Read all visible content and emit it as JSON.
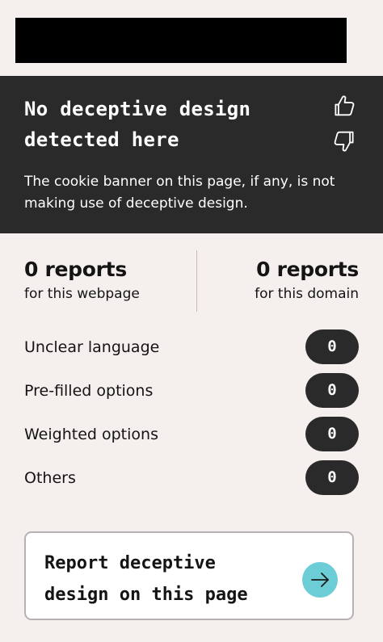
{
  "status": {
    "title": "No deceptive design detected here",
    "description": "The cookie banner on this page, if any, is not making use of deceptive design.",
    "icons": {
      "upvote": "thumbs-up-icon",
      "downvote": "thumbs-down-icon"
    }
  },
  "reports": {
    "webpage": {
      "count": "0 reports",
      "label": "for this webpage"
    },
    "domain": {
      "count": "0 reports",
      "label": "for this domain"
    }
  },
  "categories": [
    {
      "label": "Unclear language",
      "count": "0"
    },
    {
      "label": "Pre-filled options",
      "count": "0"
    },
    {
      "label": "Weighted options",
      "count": "0"
    },
    {
      "label": "Others",
      "count": "0"
    }
  ],
  "cta": {
    "label": "Report deceptive design on this page",
    "icon": "arrow-right-icon",
    "icon_color": "#6ccdd6"
  },
  "colors": {
    "background": "#f5efee",
    "panel": "#2b2a2b",
    "accent": "#6ccdd6"
  }
}
